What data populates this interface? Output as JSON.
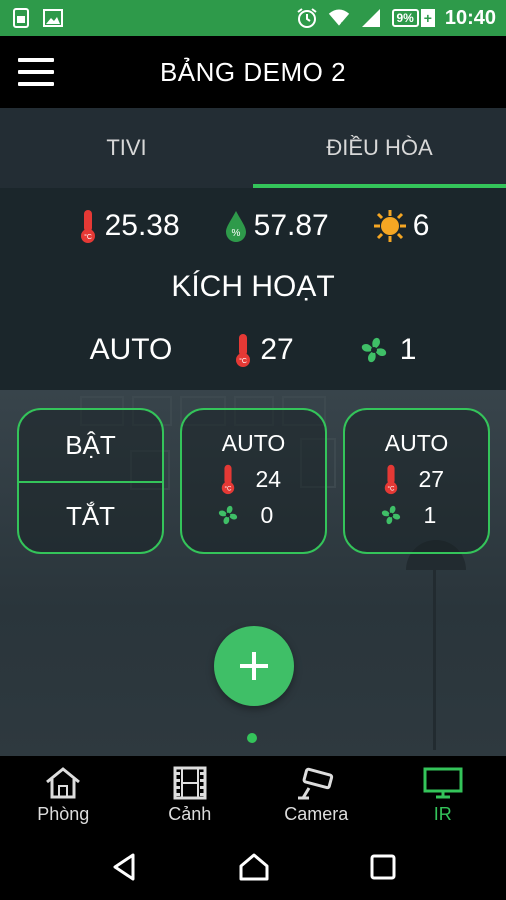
{
  "status_bar": {
    "battery_percent": "9%",
    "time": "10:40",
    "icons": [
      "sim-icon",
      "image-icon",
      "alarm-icon",
      "wifi-icon",
      "signal-icon",
      "battery-icon"
    ]
  },
  "app_bar": {
    "title": "BẢNG DEMO 2"
  },
  "tabs": [
    {
      "label": "TIVI",
      "active": false
    },
    {
      "label": "ĐIỀU HÒA",
      "active": true
    }
  ],
  "sensors": {
    "temperature": "25.38",
    "humidity": "57.87",
    "light": "6"
  },
  "status": {
    "title": "KÍCH HOẠT",
    "mode": "AUTO",
    "temperature": "27",
    "fan": "1"
  },
  "controls": {
    "on_label": "BẬT",
    "off_label": "TẮT"
  },
  "presets": [
    {
      "mode": "AUTO",
      "temperature": "24",
      "fan": "0"
    },
    {
      "mode": "AUTO",
      "temperature": "27",
      "fan": "1"
    }
  ],
  "bottom_nav": [
    {
      "label": "Phòng",
      "icon": "home-icon"
    },
    {
      "label": "Cảnh",
      "icon": "film-icon"
    },
    {
      "label": "Camera",
      "icon": "camera-icon"
    },
    {
      "label": "IR",
      "icon": "tv-icon",
      "active": true
    }
  ],
  "colors": {
    "accent": "#34c45a",
    "status_bar": "#2e9a4a"
  }
}
